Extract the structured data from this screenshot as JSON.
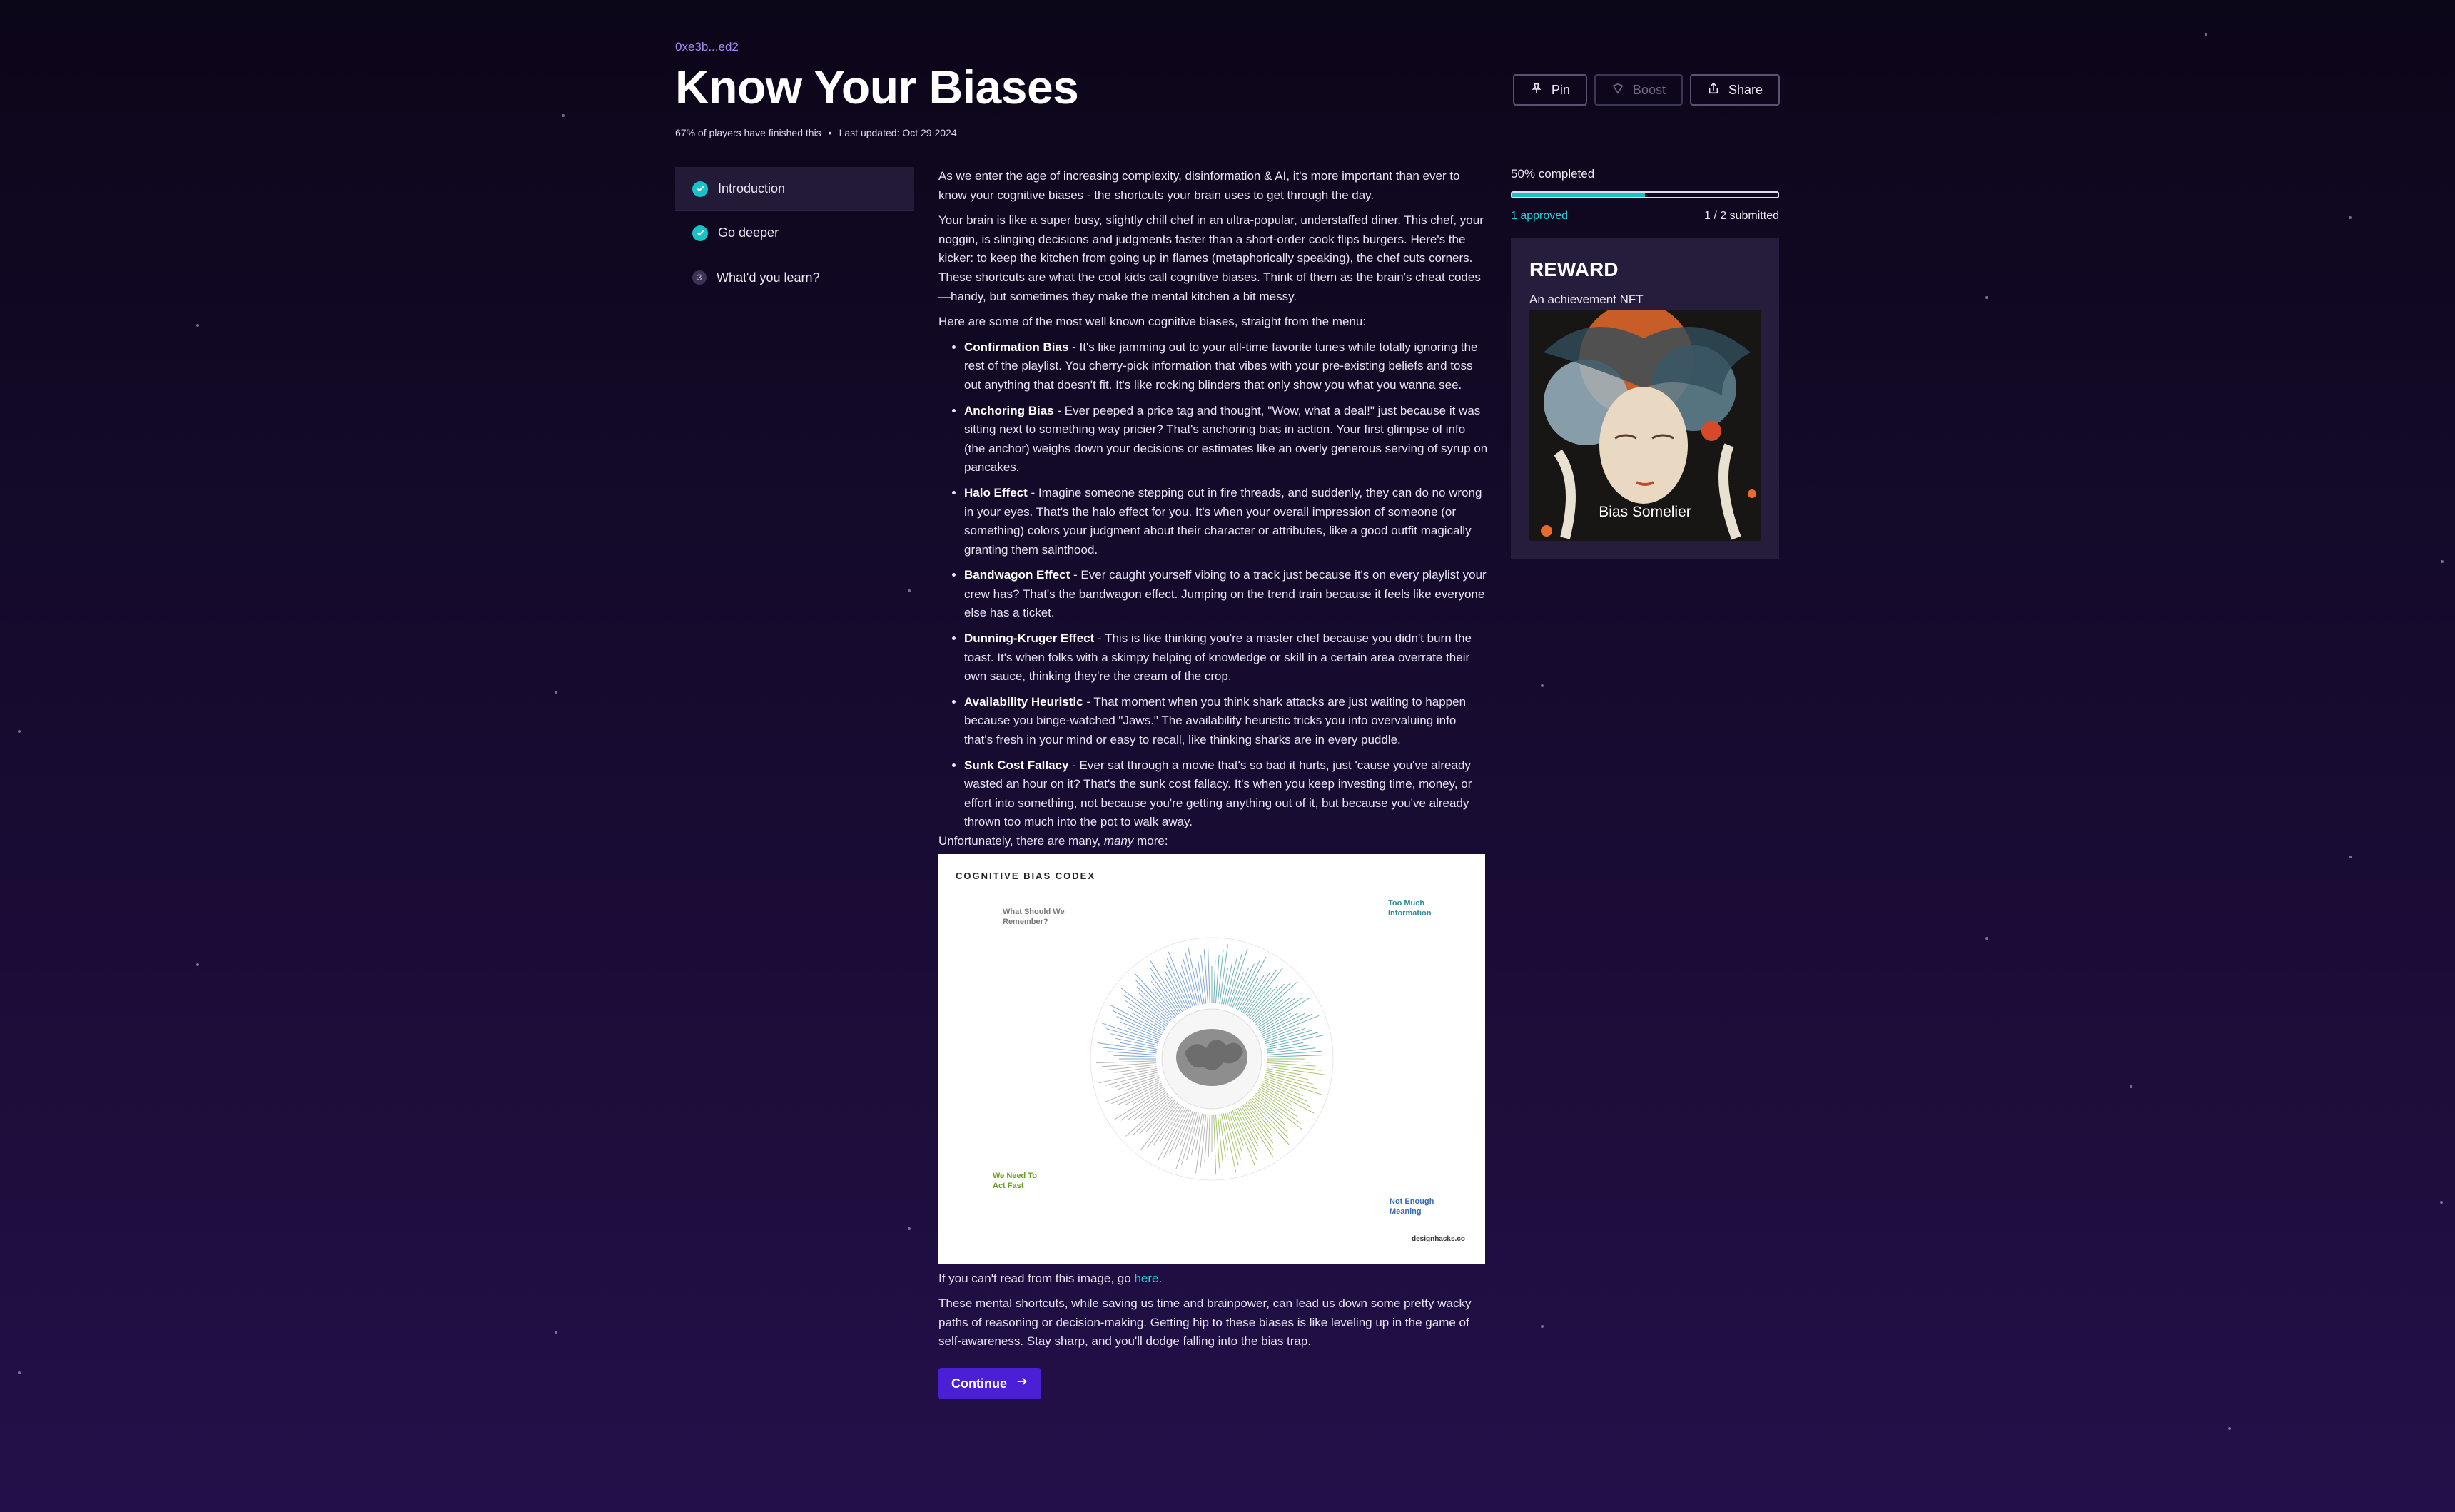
{
  "header": {
    "address": "0xe3b...ed2",
    "title": "Know Your Biases",
    "players_finished": "67% of players have finished this",
    "last_updated": "Last updated: Oct 29 2024"
  },
  "actions": {
    "pin": "Pin",
    "boost": "Boost",
    "share": "Share"
  },
  "steps": [
    {
      "label": "Introduction",
      "status": "complete",
      "num": ""
    },
    {
      "label": "Go deeper",
      "status": "complete",
      "num": ""
    },
    {
      "label": "What'd you learn?",
      "status": "pending",
      "num": "3"
    }
  ],
  "content": {
    "intro1": "As we enter the age of increasing complexity, disinformation & AI, it's more important than ever to know your cognitive biases - the shortcuts your brain uses to get through the day.",
    "intro2": "Your brain is like a super busy, slightly chill chef in an ultra-popular, understaffed diner. This chef, your noggin, is slinging decisions and judgments faster than a short-order cook flips burgers. Here's the kicker: to keep the kitchen from going up in flames (metaphorically speaking), the chef cuts corners. These shortcuts are what the cool kids call cognitive biases. Think of them as the brain's cheat codes—handy, but sometimes they make the mental kitchen a bit messy.",
    "intro3": "Here are some of the most well known cognitive biases, straight from the menu:",
    "biases": [
      {
        "name": "Confirmation Bias",
        "text": " - It's like jamming out to your all-time favorite tunes while totally ignoring the rest of the playlist. You cherry-pick information that vibes with your pre-existing beliefs and toss out anything that doesn't fit. It's like rocking blinders that only show you what you wanna see."
      },
      {
        "name": "Anchoring Bias",
        "text": " - Ever peeped a price tag and thought, \"Wow, what a deal!\" just because it was sitting next to something way pricier? That's anchoring bias in action. Your first glimpse of info (the anchor) weighs down your decisions or estimates like an overly generous serving of syrup on pancakes."
      },
      {
        "name": "Halo Effect",
        "text": " - Imagine someone stepping out in fire threads, and suddenly, they can do no wrong in your eyes. That's the halo effect for you. It's when your overall impression of someone (or something) colors your judgment about their character or attributes, like a good outfit magically granting them sainthood."
      },
      {
        "name": "Bandwagon Effect",
        "text": " - Ever caught yourself vibing to a track just because it's on every playlist your crew has? That's the bandwagon effect. Jumping on the trend train because it feels like everyone else has a ticket."
      },
      {
        "name": "Dunning-Kruger Effect",
        "text": " - This is like thinking you're a master chef because you didn't burn the toast. It's when folks with a skimpy helping of knowledge or skill in a certain area overrate their own sauce, thinking they're the cream of the crop."
      },
      {
        "name": "Availability Heuristic",
        "text": " - That moment when you think shark attacks are just waiting to happen because you binge-watched \"Jaws.\" The availability heuristic tricks you into overvaluing info that's fresh in your mind or easy to recall, like thinking sharks are in every puddle."
      },
      {
        "name": "Sunk Cost Fallacy",
        "text": " - Ever sat through a movie that's so bad it hurts, just 'cause you've already wasted an hour on it? That's the sunk cost fallacy. It's when you keep investing time, money, or effort into something, not because you're getting anything out of it, but because you've already thrown too much into the pot to walk away."
      }
    ],
    "more_prefix": "Unfortunately, there are many, ",
    "more_em": "many",
    "more_suffix": " more:",
    "codex": {
      "title": "COGNITIVE BIAS CODEX",
      "q1": "What Should We Remember?",
      "q2": "Too Much Information",
      "q3": "We Need To Act Fast",
      "q4": "Not Enough Meaning",
      "site": "designhacks.co"
    },
    "cant_read_prefix": "If you can't read from this image, go ",
    "cant_read_link": "here",
    "cant_read_suffix": ".",
    "outro": "These mental shortcuts, while saving us time and brainpower, can lead us down some pretty wacky paths of reasoning or decision-making. Getting hip to these biases is like leveling up in the game of self-awareness. Stay sharp, and you'll dodge falling into the bias trap.",
    "continue": "Continue"
  },
  "progress": {
    "label": "50% completed",
    "fraction": 0.5,
    "approved": "1 approved",
    "submitted": "1 / 2 submitted"
  },
  "reward": {
    "heading": "REWARD",
    "label": "An achievement NFT",
    "nft_caption": "Bias Somelier"
  },
  "colors": {
    "accent": "#18c3c8",
    "button": "#4b1fd6",
    "link": "#9f8cf0"
  }
}
